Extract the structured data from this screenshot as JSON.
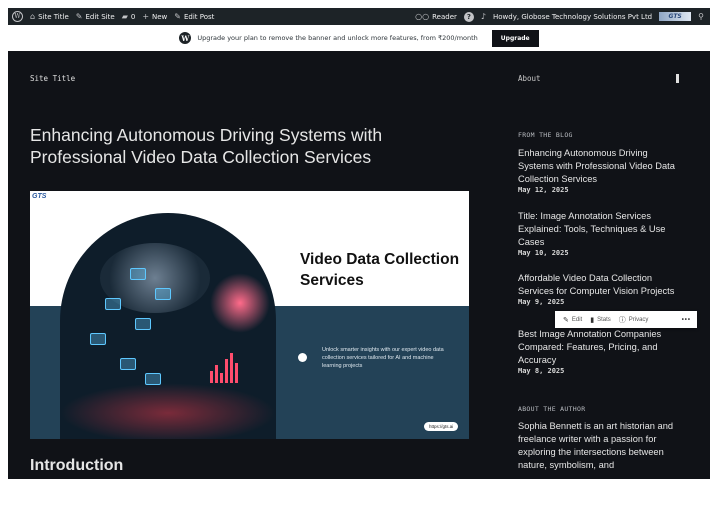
{
  "admin_bar": {
    "site_title": "Site Title",
    "edit_site": "Edit Site",
    "comments_count": "0",
    "new_label": "New",
    "edit_post": "Edit Post",
    "reader": "Reader",
    "howdy": "Howdy, Globose Technology Solutions Pvt Ltd",
    "avatar_text": "GTS"
  },
  "banner": {
    "text": "Upgrade your plan to remove the banner and unlock more features, from ₹200/month",
    "button": "Upgrade"
  },
  "header": {
    "site_title": "Site Title",
    "about": "About"
  },
  "post": {
    "title": "Enhancing Autonomous Driving Systems with Professional Video Data Collection Services",
    "intro_heading": "Introduction"
  },
  "hero": {
    "logo": "GTS",
    "heading": "Video Data Collection Services",
    "subtext": "Unlock smarter insights with our expert video data collection services tailored for AI and machine learning projects",
    "url": "https://gts.ai"
  },
  "sidebar": {
    "blog_label": "FROM THE BLOG",
    "posts": [
      {
        "title": "Enhancing Autonomous Driving Systems with Professional Video Data Collection Services",
        "date": "May 12, 2025"
      },
      {
        "title": "Title: Image Annotation Services Explained: Tools, Techniques & Use Cases",
        "date": "May 10, 2025"
      },
      {
        "title": "Affordable Video Data Collection Services for Computer Vision Projects",
        "date": "May 9, 2025"
      },
      {
        "title": "Best Image Annotation Companies Compared: Features, Pricing, and Accuracy",
        "date": "May 8, 2025"
      }
    ],
    "author_label": "ABOUT THE AUTHOR",
    "author_bio": "Sophia Bennett is an art historian and freelance writer with a passion for exploring the intersections between nature, symbolism, and"
  },
  "toolbar": {
    "edit": "Edit",
    "stats": "Stats",
    "privacy": "Privacy",
    "more": "•••"
  },
  "colors": {
    "page_bg": "#101217",
    "admin_bar": "#1d2327",
    "hero_navy": "#234257"
  }
}
